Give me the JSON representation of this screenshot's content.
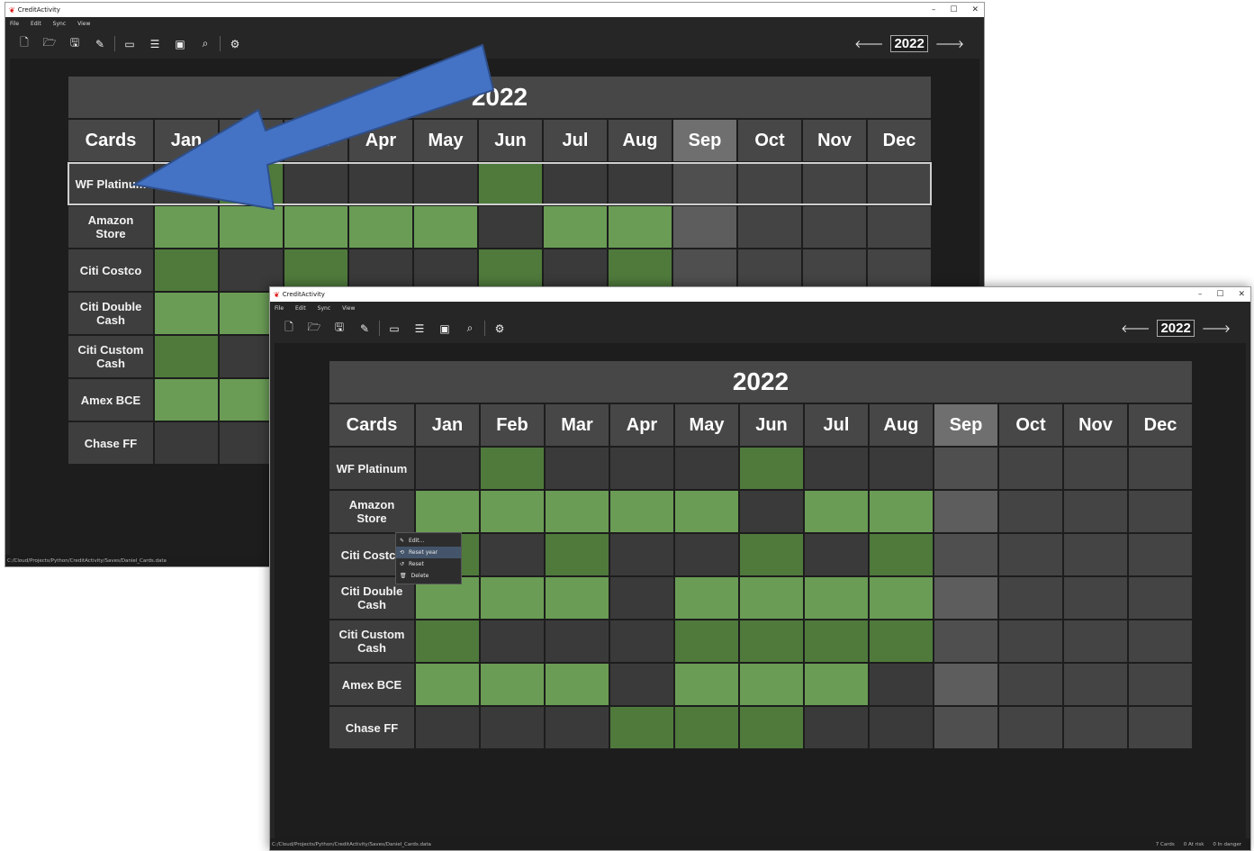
{
  "app": {
    "title": "CreditActivity",
    "icon": "app-logo-icon"
  },
  "menu": [
    "File",
    "Edit",
    "Sync",
    "View"
  ],
  "toolbar": [
    {
      "icon": "new-file-icon",
      "glyph": "🗋"
    },
    {
      "icon": "open-folder-icon",
      "glyph": "🗁"
    },
    {
      "icon": "save-icon",
      "glyph": "🖫"
    },
    {
      "icon": "save-as-icon",
      "glyph": "✎"
    },
    {
      "icon": "card-add-icon",
      "glyph": "▭"
    },
    {
      "icon": "card-stack-icon",
      "glyph": "☰"
    },
    {
      "icon": "card-search-icon",
      "glyph": "▣"
    },
    {
      "icon": "card-find-icon",
      "glyph": "⌕"
    },
    {
      "icon": "settings-gear-icon",
      "glyph": "⚙"
    }
  ],
  "year": "2022",
  "window_controls": [
    "–",
    "☐",
    "✕"
  ],
  "columns": [
    "Cards",
    "Jan",
    "Feb",
    "Mar",
    "Apr",
    "May",
    "Jun",
    "Jul",
    "Aug",
    "Sep",
    "Oct",
    "Nov",
    "Dec"
  ],
  "current_month_index": 8,
  "cards": [
    {
      "name": "WF Platinum",
      "months": [
        "g",
        "d",
        "g",
        "g",
        "g",
        "d",
        "g",
        "g",
        "c",
        "g",
        "g",
        "g"
      ]
    },
    {
      "name": "Amazon Store",
      "months": [
        "l",
        "l",
        "l",
        "l",
        "l",
        "g",
        "l",
        "l",
        "c",
        "g",
        "g",
        "g"
      ]
    },
    {
      "name": "Citi Costco",
      "months": [
        "d",
        "g",
        "d",
        "g",
        "g",
        "d",
        "g",
        "d",
        "c",
        "g",
        "g",
        "g"
      ]
    },
    {
      "name": "Citi Double Cash",
      "months": [
        "l",
        "l",
        "l",
        "g",
        "l",
        "l",
        "l",
        "l",
        "c",
        "g",
        "g",
        "g"
      ]
    },
    {
      "name": "Citi Custom Cash",
      "months": [
        "d",
        "g",
        "g",
        "g",
        "d",
        "d",
        "d",
        "d",
        "c",
        "g",
        "g",
        "g"
      ]
    },
    {
      "name": "Amex BCE",
      "months": [
        "l",
        "l",
        "l",
        "g",
        "l",
        "l",
        "l",
        "g",
        "c",
        "g",
        "g",
        "g"
      ]
    },
    {
      "name": "Chase FF",
      "months": [
        "g",
        "g",
        "g",
        "d",
        "d",
        "d",
        "g",
        "g",
        "c",
        "g",
        "g",
        "g"
      ]
    }
  ],
  "context_menu": [
    {
      "label": "Edit...",
      "icon": "edit-icon",
      "glyph": "✎"
    },
    {
      "label": "Reset year",
      "icon": "reset-year-icon",
      "glyph": "⟲",
      "highlighted": true
    },
    {
      "label": "Reset",
      "icon": "reset-icon",
      "glyph": "↺"
    },
    {
      "label": "Delete",
      "icon": "trash-icon",
      "glyph": "🗑"
    }
  ],
  "status": {
    "path": "C:/Cloud/Projects/Python/CreditActivity/Saves/Daniel_Cards.data",
    "cards": "7 Cards",
    "at_risk": "0 At risk",
    "in_danger": "0 In danger"
  },
  "colors": {
    "active_light": "#6a9c55",
    "active_dark": "#4f7a3c",
    "inactive": "#3a3a3a",
    "annotation_arrow": "#4472c4"
  }
}
